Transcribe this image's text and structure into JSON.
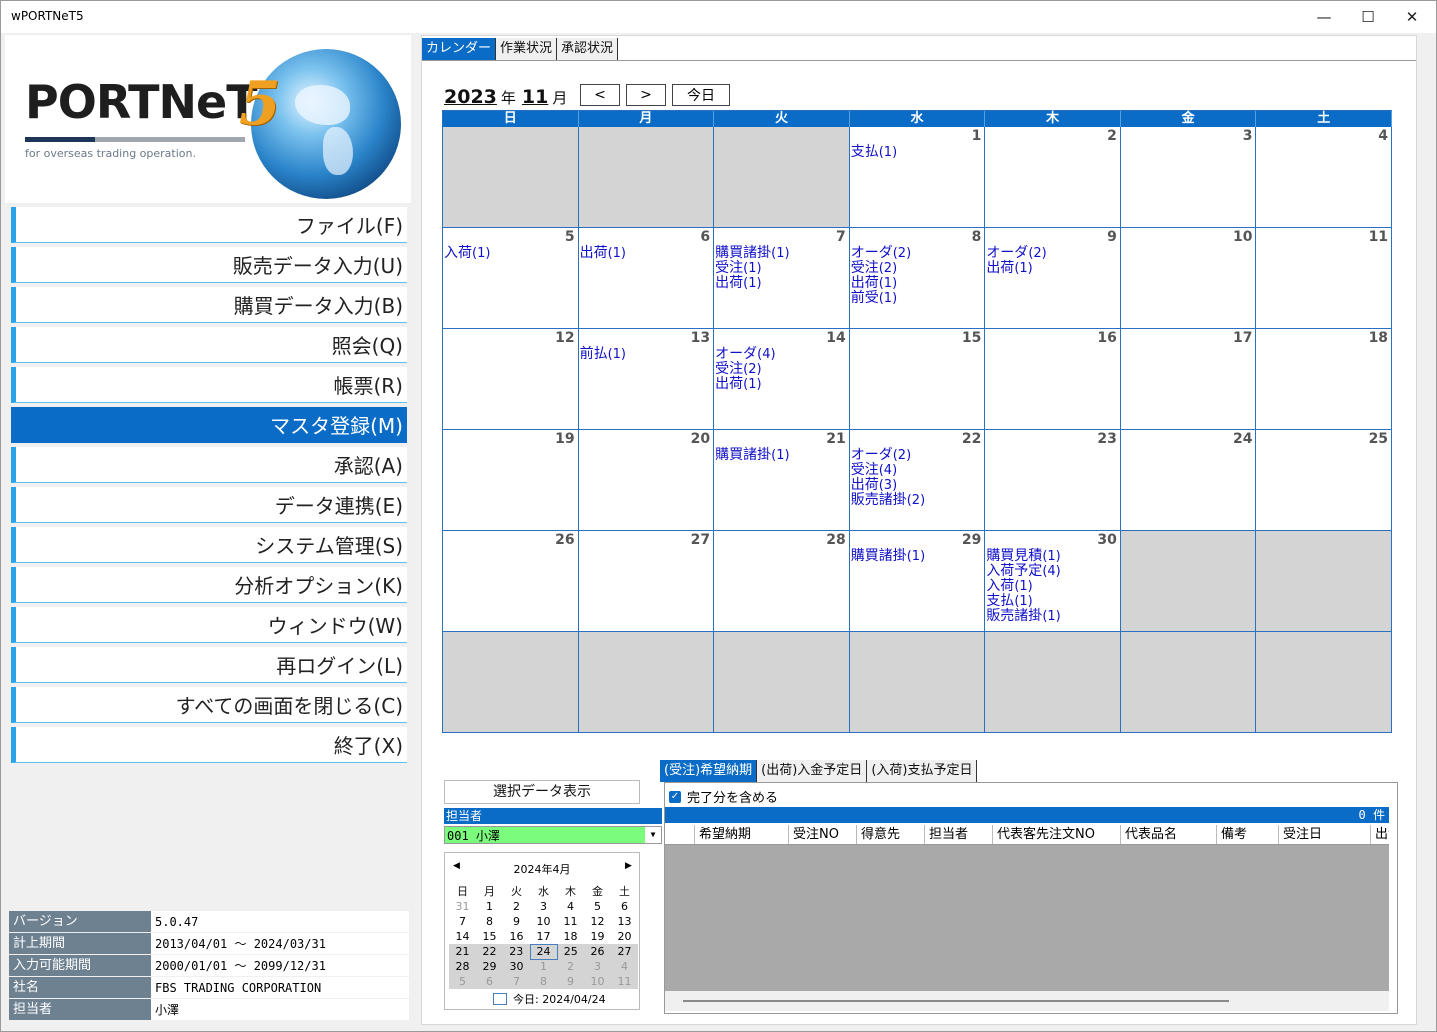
{
  "window": {
    "title": "wPORTNeT5"
  },
  "logo": {
    "brand": "PORTNeT",
    "version_mark": "5",
    "tagline": "for overseas trading operation."
  },
  "menu": [
    {
      "label": "ファイル(F)"
    },
    {
      "label": "販売データ入力(U)"
    },
    {
      "label": "購買データ入力(B)"
    },
    {
      "label": "照会(Q)"
    },
    {
      "label": "帳票(R)"
    },
    {
      "label": "マスタ登録(M)",
      "active": true
    },
    {
      "label": "承認(A)"
    },
    {
      "label": "データ連携(E)"
    },
    {
      "label": "システム管理(S)"
    },
    {
      "label": "分析オプション(K)"
    },
    {
      "label": "ウィンドウ(W)"
    },
    {
      "label": "再ログイン(L)"
    },
    {
      "label": "すべての画面を閉じる(C)"
    },
    {
      "label": "終了(X)"
    }
  ],
  "info": [
    {
      "key": "バージョン",
      "value": "5.0.47"
    },
    {
      "key": "計上期間",
      "value": "2013/04/01 ～ 2024/03/31"
    },
    {
      "key": "入力可能期間",
      "value": "2000/01/01 ～ 2099/12/31"
    },
    {
      "key": "社名",
      "value": "FBS TRADING CORPORATION"
    },
    {
      "key": "担当者",
      "value": "小澤"
    }
  ],
  "top_tabs": [
    "カレンダー",
    "作業状況",
    "承認状況"
  ],
  "calendar": {
    "year": "2023",
    "year_unit": "年",
    "month": "11",
    "month_unit": "月",
    "prev": "<",
    "next": ">",
    "today_btn": "今日",
    "weekdays": [
      "日",
      "月",
      "火",
      "水",
      "木",
      "金",
      "土"
    ],
    "weeks": [
      [
        {
          "d": ""
        },
        {
          "d": ""
        },
        {
          "d": ""
        },
        {
          "d": "1",
          "ev": [
            [
              "支払",
              "(1)"
            ]
          ]
        },
        {
          "d": "2"
        },
        {
          "d": "3"
        },
        {
          "d": "4"
        }
      ],
      [
        {
          "d": "5",
          "ev": [
            [
              "入荷",
              "(1)"
            ]
          ]
        },
        {
          "d": "6",
          "ev": [
            [
              "出荷",
              "(1)"
            ]
          ]
        },
        {
          "d": "7",
          "ev": [
            [
              "購買諸掛",
              "(1)"
            ],
            [
              "受注",
              "(1)"
            ],
            [
              "出荷",
              "(1)"
            ]
          ]
        },
        {
          "d": "8",
          "ev": [
            [
              "オーダ",
              "(2)"
            ],
            [
              "受注",
              "(2)"
            ],
            [
              "出荷",
              "(1)"
            ],
            [
              "前受",
              "(1)"
            ]
          ]
        },
        {
          "d": "9",
          "ev": [
            [
              "オーダ",
              "(2)"
            ],
            [
              "出荷",
              "(1)"
            ]
          ]
        },
        {
          "d": "10"
        },
        {
          "d": "11"
        }
      ],
      [
        {
          "d": "12"
        },
        {
          "d": "13",
          "ev": [
            [
              "前払",
              "(1)"
            ]
          ]
        },
        {
          "d": "14",
          "ev": [
            [
              "オーダ",
              "(4)"
            ],
            [
              "受注",
              "(2)"
            ],
            [
              "出荷",
              "(1)"
            ]
          ]
        },
        {
          "d": "15"
        },
        {
          "d": "16"
        },
        {
          "d": "17"
        },
        {
          "d": "18"
        }
      ],
      [
        {
          "d": "19"
        },
        {
          "d": "20"
        },
        {
          "d": "21",
          "ev": [
            [
              "購買諸掛",
              "(1)"
            ]
          ]
        },
        {
          "d": "22",
          "ev": [
            [
              "オーダ",
              "(2)"
            ],
            [
              "受注",
              "(4)"
            ],
            [
              "出荷",
              "(3)"
            ],
            [
              "販売諸掛",
              "(2)"
            ]
          ]
        },
        {
          "d": "23"
        },
        {
          "d": "24"
        },
        {
          "d": "25"
        }
      ],
      [
        {
          "d": "26"
        },
        {
          "d": "27"
        },
        {
          "d": "28"
        },
        {
          "d": "29",
          "ev": [
            [
              "購買諸掛",
              "(1)"
            ]
          ]
        },
        {
          "d": "30",
          "ev": [
            [
              "購買見積",
              "(1)"
            ],
            [
              "入荷予定",
              "(4)"
            ],
            [
              "入荷",
              "(1)"
            ],
            [
              "支払",
              "(1)"
            ],
            [
              "販売諸掛",
              "(1)"
            ]
          ]
        },
        {
          "d": ""
        },
        {
          "d": ""
        }
      ],
      [
        {
          "d": ""
        },
        {
          "d": ""
        },
        {
          "d": ""
        },
        {
          "d": ""
        },
        {
          "d": ""
        },
        {
          "d": ""
        },
        {
          "d": ""
        }
      ]
    ]
  },
  "select_button": "選択データ表示",
  "tanto": {
    "label": "担当者",
    "value": "001 小澤"
  },
  "minical": {
    "title": "2024年4月",
    "weekdays": [
      "日",
      "月",
      "火",
      "水",
      "木",
      "金",
      "土"
    ],
    "rows": [
      [
        "31",
        "1",
        "2",
        "3",
        "4",
        "5",
        "6"
      ],
      [
        "7",
        "8",
        "9",
        "10",
        "11",
        "12",
        "13"
      ],
      [
        "14",
        "15",
        "16",
        "17",
        "18",
        "19",
        "20"
      ],
      [
        "21",
        "22",
        "23",
        "24",
        "25",
        "26",
        "27"
      ],
      [
        "28",
        "29",
        "30",
        "1",
        "2",
        "3",
        "4"
      ],
      [
        "5",
        "6",
        "7",
        "8",
        "9",
        "10",
        "11"
      ]
    ],
    "today_text": "今日: 2024/04/24"
  },
  "bottom_tabs": [
    "(受注)希望納期",
    "(出荷)入金予定日",
    "(入荷)支払予定日"
  ],
  "include_done": "完了分を含める",
  "count": "0 件",
  "grid_columns": [
    "",
    "希望納期",
    "受注NO",
    "得意先",
    "担当者",
    "代表客先注文NO",
    "代表品名",
    "備考",
    "受注日",
    "出港"
  ]
}
